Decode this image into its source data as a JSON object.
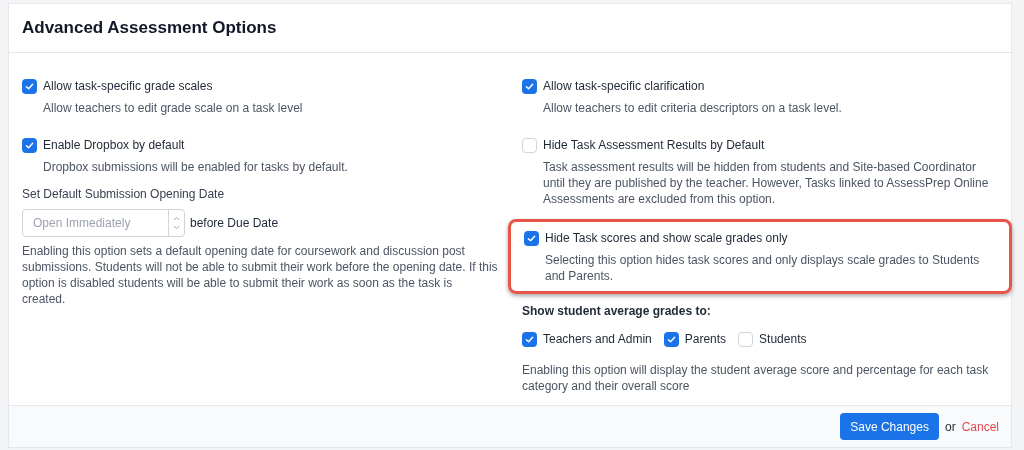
{
  "title": "Advanced Assessment Options",
  "left_options": [
    {
      "label": "Allow task-specific grade scales",
      "checked": true,
      "description": "Allow teachers to edit grade scale on a task level"
    },
    {
      "label": "Enable Dropbox by default",
      "checked": true,
      "description": "Dropbox submissions will be enabled for tasks by default."
    }
  ],
  "opening_date": {
    "label": "Set Default Submission Opening Date",
    "placeholder": "Open Immediately",
    "suffix": "before Due Date",
    "description": "Enabling this option sets a default opening date for coursework and discussion post submissions. Students will not be able to submit their work before the opening date. If this option is disabled students will be able to submit their work as soon as the task is created."
  },
  "right_options": [
    {
      "label": "Allow task-specific clarification",
      "checked": true,
      "highlighted": false,
      "description": "Allow teachers to edit criteria descriptors on a task level."
    },
    {
      "label": "Hide Task Assessment Results by Default",
      "checked": false,
      "highlighted": false,
      "description": "Task assessment results will be hidden from students and Site-based Coordinator until they are published by the teacher. However, Tasks linked to AssessPrep Online Assessments are excluded from this option."
    },
    {
      "label": "Hide Task scores and show scale grades only",
      "checked": true,
      "highlighted": true,
      "description": "Selecting this option hides task scores and only displays scale grades to Students and Parents."
    }
  ],
  "average_grades": {
    "label": "Show student average grades to:",
    "audiences": [
      {
        "label": "Teachers and Admin",
        "checked": true
      },
      {
        "label": "Parents",
        "checked": true
      },
      {
        "label": "Students",
        "checked": false
      }
    ],
    "description": "Enabling this option will display the student average score and percentage for each task category and their overall score"
  },
  "footer": {
    "save": "Save Changes",
    "or": "or",
    "cancel": "Cancel"
  }
}
